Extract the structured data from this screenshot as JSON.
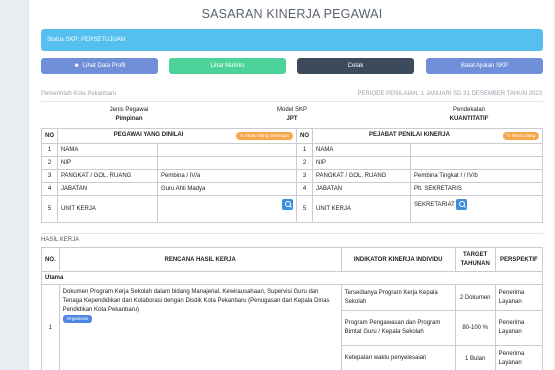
{
  "page_title": "SASARAN KINERJA PEGAWAI",
  "status_text": "Status SKP: PERSETUJUAN",
  "buttons": {
    "lihat_profil": "Lihat Data Profil",
    "lihat_matriks": "Lihat Matriks",
    "cetak": "Cetak",
    "batal_ajukan": "Batal Ajukan SKP"
  },
  "meta": {
    "instansi": "Pemerintah Kota Pekanbaru",
    "periode": "PERIODE PENILAIAN: 1 JANUARI SD 31 DESEMBER TAHUN 2023"
  },
  "jabatan": {
    "jenis_label": "Jenis Pegawai",
    "jenis_value": "Pimpinan",
    "model_label": "Model SKP",
    "model_value": "JPT",
    "pendekatan_label": "Pendekatan",
    "pendekatan_value": "KUANTITATIF"
  },
  "dinilai": {
    "no_header": "NO",
    "header": "PEGAWAI YANG DINILAI",
    "ubah_btn": "↻ Muat Ulang Golongan",
    "rows": [
      {
        "no": "1",
        "label": "NAMA",
        "value": ""
      },
      {
        "no": "2",
        "label": "NIP",
        "value": ""
      },
      {
        "no": "3",
        "label": "PANGKAT / GOL. RUANG",
        "value": "Pembina / IV/a"
      },
      {
        "no": "4",
        "label": "JABATAN",
        "value": "Guru Ahli Madya"
      },
      {
        "no": "5",
        "label": "UNIT KERJA",
        "value": ""
      }
    ]
  },
  "penilai": {
    "no_header": "NO",
    "header": "PEJABAT PENILAI KINERJA",
    "ubah_btn": "↻ Muat Ulang",
    "rows": [
      {
        "no": "1",
        "label": "NAMA",
        "value": ""
      },
      {
        "no": "2",
        "label": "NIP",
        "value": ""
      },
      {
        "no": "3",
        "label": "PANGKAT / GOL. RUANG",
        "value": "Pembina Tingkat I / IV/b"
      },
      {
        "no": "4",
        "label": "JABATAN",
        "value": "Plt. SEKRETARIS"
      },
      {
        "no": "5",
        "label": "UNIT KERJA",
        "value": "SEKRETARIAT"
      }
    ]
  },
  "hasil_kerja": {
    "section_label": "HASIL KERJA",
    "headers": {
      "no": "NO.",
      "rencana": "RENCANA HASIL KERJA",
      "indikator": "INDIKATOR KINERJA INDIVIDU",
      "target": "TARGET TAHUNAN",
      "perspektif": "PERSPEKTIF"
    },
    "group": "Utama",
    "row_no": "1",
    "rencana_text": "Dokumen Program Kerja Sekolah dalam bidang Manajerial, Kewirausahaan, Supervisi Guru dan Tenaga Kependidikan dan Kolaborasi dengan Disdik Kota Pekanbaru (Penugasan dari Kepala Dinas Pendidikan Kota Pekanbaru)",
    "tag": "Organisasi",
    "indikators": [
      {
        "text": "Tersedianya Program Kerja Kepala Sekolah",
        "target": "2 Dokumen",
        "perspektif": "Penerima Layanan"
      },
      {
        "text": "Program Pengawasan dan Program Bimtat Guru / Kepala Sekolah",
        "target": "80-100 %",
        "perspektif": "Penerima Layanan"
      },
      {
        "text": "Ketepatan waktu penyelesaian",
        "target": "1 Bulan",
        "perspektif": "Penerima Layanan"
      }
    ]
  }
}
